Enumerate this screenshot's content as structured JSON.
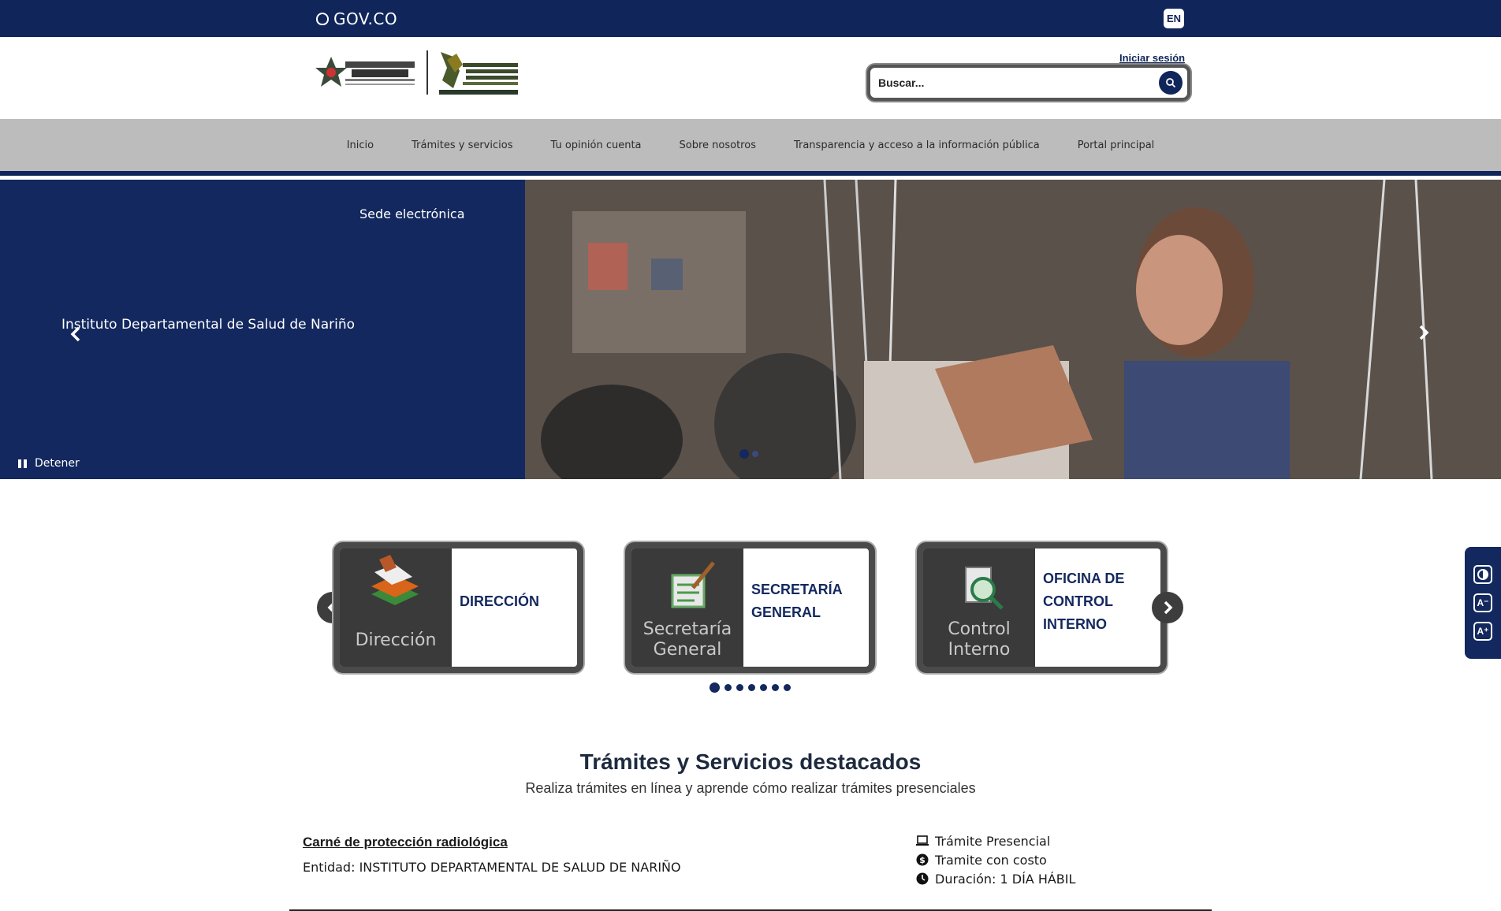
{
  "govbar": {
    "brand": "GOV.CO",
    "lang_button": "EN"
  },
  "header": {
    "login_link": "Iniciar sesión",
    "search": {
      "placeholder": "Buscar..."
    }
  },
  "nav": {
    "items": [
      {
        "label": "Inicio"
      },
      {
        "label": "Trámites y servicios"
      },
      {
        "label": "Tu opinión cuenta"
      },
      {
        "label": "Sobre nosotros"
      },
      {
        "label": "Transparencia y acceso a la información pública"
      },
      {
        "label": "Portal principal"
      }
    ]
  },
  "hero": {
    "kicker": "Sede electrónica",
    "title": "Instituto Departamental de Salud de Nariño",
    "pause_label": "Detener",
    "slides_total": 2,
    "active_slide": 1
  },
  "cards": {
    "items": [
      {
        "image_label": "Dirección",
        "title": "DIRECCIÓN"
      },
      {
        "image_label_1": "Secretaría",
        "image_label_2": "General",
        "title": "SECRETARÍA GENERAL"
      },
      {
        "image_label_1": "Control",
        "image_label_2": "Interno",
        "title": "OFICINA DE CONTROL INTERNO"
      }
    ],
    "pages_total": 7,
    "active_page": 1
  },
  "section": {
    "title": "Trámites y Servicios destacados",
    "subtitle": "Realiza trámites en línea y aprende cómo realizar trámites presenciales",
    "procedure": {
      "name": "Carné de protección radiológica",
      "entity": "Entidad: INSTITUTO DEPARTAMENTAL DE SALUD DE NARIÑO",
      "mode": "Trámite Presencial",
      "cost": "Tramite con costo",
      "duration": "Duración: 1 DÍA HÁBIL"
    }
  },
  "colors": {
    "primary": "#13285e",
    "govbar": "#10255a",
    "nav_bg": "#bcbcbc"
  },
  "icons": [
    "shield-icon",
    "search-icon",
    "chevron-left-icon",
    "chevron-right-icon",
    "pause-icon",
    "contrast-icon",
    "font-decrease-icon",
    "font-increase-icon",
    "laptop-icon",
    "dollar-icon",
    "clock-icon"
  ]
}
